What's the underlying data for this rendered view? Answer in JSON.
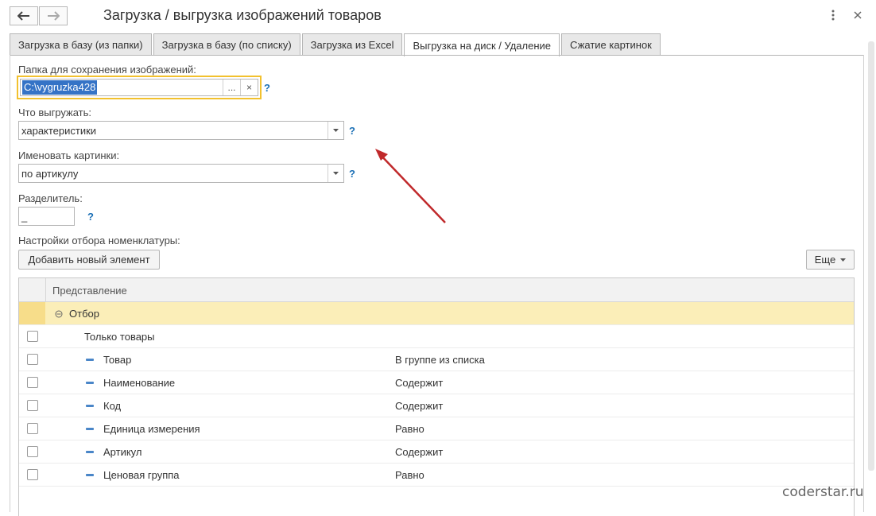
{
  "window": {
    "title": "Загрузка / выгрузка изображений товаров"
  },
  "tabs": [
    {
      "label": "Загрузка в базу (из папки)",
      "active": false
    },
    {
      "label": "Загрузка в базу (по списку)",
      "active": false
    },
    {
      "label": "Загрузка из Excel",
      "active": false
    },
    {
      "label": "Выгрузка на диск / Удаление",
      "active": true
    },
    {
      "label": "Сжатие картинок",
      "active": false
    }
  ],
  "form": {
    "folder": {
      "label": "Папка для сохранения изображений:",
      "value": "C:\\vygruzka428",
      "select_btn": "...",
      "clear_btn": "×",
      "help": "?"
    },
    "what": {
      "label": "Что выгружать:",
      "value": "характеристики",
      "help": "?"
    },
    "naming": {
      "label": "Именовать картинки:",
      "value": "по артикулу",
      "help": "?"
    },
    "separator": {
      "label": "Разделитель:",
      "value": "_",
      "help": "?"
    },
    "filter_label": "Настройки отбора номенклатуры:",
    "add_button": "Добавить новый элемент",
    "more_button": "Еще"
  },
  "table": {
    "header": "Представление",
    "group": {
      "label": "Отбор"
    },
    "rows": [
      {
        "name": "Только товары",
        "condition": ""
      },
      {
        "name": "Товар",
        "condition": "В группе из списка"
      },
      {
        "name": "Наименование",
        "condition": "Содержит"
      },
      {
        "name": "Код",
        "condition": "Содержит"
      },
      {
        "name": "Единица измерения",
        "condition": "Равно"
      },
      {
        "name": "Артикул",
        "condition": "Содержит"
      },
      {
        "name": "Ценовая группа",
        "condition": "Равно"
      }
    ]
  },
  "watermark": "coderstar.ru",
  "colors": {
    "accent": "#1a6fb5",
    "arrow": "#c0292b",
    "group_bg": "#fbeeb8",
    "focus": "#f2c12e"
  }
}
